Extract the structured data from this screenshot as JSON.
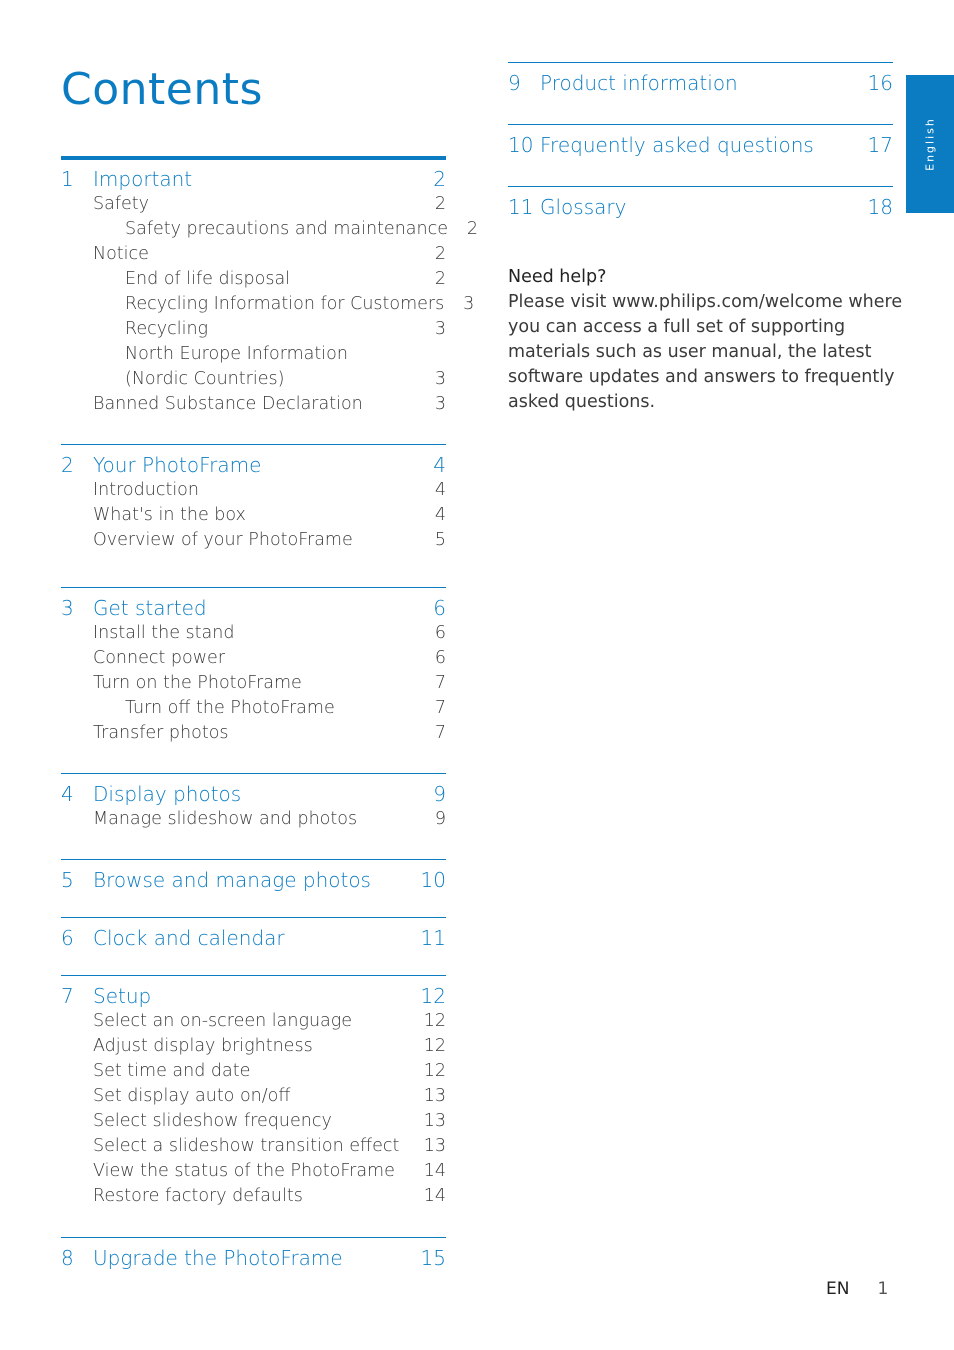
{
  "page_title": "Contents",
  "language_tab": "English",
  "toc_left": [
    {
      "number": "1",
      "title": "Important",
      "page": "2",
      "thick": true,
      "entries": [
        {
          "level": 1,
          "label": "Safety",
          "page": "2"
        },
        {
          "level": 2,
          "label": "Safety precautions and maintenance",
          "page": "2"
        },
        {
          "level": 1,
          "label": "Notice",
          "page": "2"
        },
        {
          "level": 2,
          "label": "End of life disposal",
          "page": "2"
        },
        {
          "level": 2,
          "label": "Recycling Information for Customers",
          "page": "3"
        },
        {
          "level": 2,
          "label": "Recycling",
          "page": "3"
        },
        {
          "level": 2,
          "label": "North Europe Information",
          "page": ""
        },
        {
          "level": 2,
          "label": "(Nordic Countries)",
          "page": "3"
        },
        {
          "level": 1,
          "label": "Banned Substance Declaration",
          "page": "3"
        }
      ]
    },
    {
      "number": "2",
      "title": "Your PhotoFrame",
      "page": "4",
      "entries": [
        {
          "level": 1,
          "label": "Introduction",
          "page": "4"
        },
        {
          "level": 1,
          "label": "What's in the box",
          "page": "4"
        },
        {
          "level": 1,
          "label": "Overview of your PhotoFrame",
          "page": "5"
        }
      ]
    },
    {
      "number": "3",
      "title": "Get started",
      "page": "6",
      "entries": [
        {
          "level": 1,
          "label": "Install the stand",
          "page": "6"
        },
        {
          "level": 1,
          "label": "Connect power",
          "page": "6"
        },
        {
          "level": 1,
          "label": "Turn on the PhotoFrame",
          "page": "7"
        },
        {
          "level": 2,
          "label": "Turn off the PhotoFrame",
          "page": "7"
        },
        {
          "level": 1,
          "label": "Transfer photos",
          "page": "7"
        }
      ]
    },
    {
      "number": "4",
      "title": "Display photos",
      "page": "9",
      "entries": [
        {
          "level": 1,
          "label": "Manage slideshow and photos",
          "page": "9"
        }
      ]
    },
    {
      "number": "5",
      "title": "Browse and manage photos",
      "page": "10",
      "entries": []
    },
    {
      "number": "6",
      "title": "Clock and calendar",
      "page": "11",
      "entries": []
    },
    {
      "number": "7",
      "title": "Setup",
      "page": "12",
      "entries": [
        {
          "level": 1,
          "label": "Select an on-screen language",
          "page": "12"
        },
        {
          "level": 1,
          "label": "Adjust display brightness",
          "page": "12"
        },
        {
          "level": 1,
          "label": "Set time and date",
          "page": "12"
        },
        {
          "level": 1,
          "label": "Set display auto on/off",
          "page": "13"
        },
        {
          "level": 1,
          "label": "Select slideshow frequency",
          "page": "13"
        },
        {
          "level": 1,
          "label": "Select a slideshow transition effect",
          "page": "13"
        },
        {
          "level": 1,
          "label": "View the status of the PhotoFrame",
          "page": "14"
        },
        {
          "level": 1,
          "label": "Restore factory defaults",
          "page": "14"
        }
      ]
    },
    {
      "number": "8",
      "title": "Upgrade the PhotoFrame",
      "page": "15",
      "entries": []
    }
  ],
  "toc_right": [
    {
      "number": "9",
      "title": "Product information",
      "page": "16",
      "entries": []
    },
    {
      "number": "10",
      "title": "Frequently asked questions",
      "page": "17",
      "entries": []
    },
    {
      "number": "11",
      "title": "Glossary",
      "page": "18",
      "entries": []
    }
  ],
  "help": {
    "title": "Need help?",
    "body": "Please visit www.philips.com/welcome where you can access a full set of supporting materials such as user manual, the latest software updates and answers to frequently asked questions."
  },
  "footer": {
    "language_code": "EN",
    "page_number": "1"
  },
  "colors": {
    "accent": "#0b7cc2",
    "text": "#3a3a3a"
  }
}
